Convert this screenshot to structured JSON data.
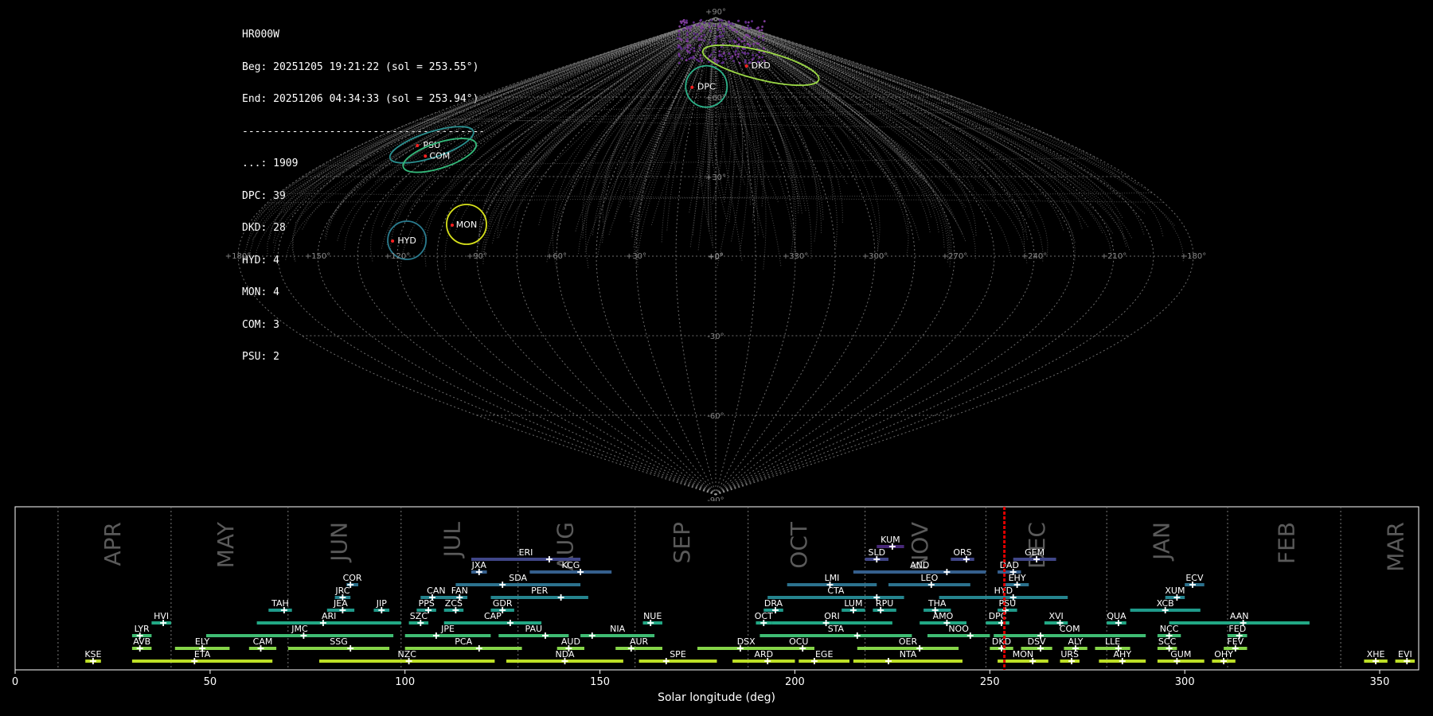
{
  "header": {
    "station": "HR000W",
    "begin": "Beg: 20251205 19:21:22 (sol = 253.55°)",
    "end": "End: 20251206 04:34:33 (sol = 253.94°)",
    "separator": "---------------------------------------",
    "counts": [
      "...: 1909",
      "DPC: 39",
      "DKD: 28",
      "HYD: 4",
      "MON: 4",
      "COM: 3",
      "PSU: 2"
    ]
  },
  "sky_map": {
    "projection": "sinusoidal",
    "lat_labels": [
      "+90°",
      "+60°",
      "+30°",
      "+0°",
      "-30°",
      "-60°",
      "-90°"
    ],
    "lon_labels": [
      "+180°",
      "+150°",
      "+120°",
      "+90°",
      "+60°",
      "+30°",
      "+0°",
      "+330°",
      "+300°",
      "+270°",
      "+240°",
      "+210°",
      "+180°"
    ],
    "radiants": [
      {
        "code": "DKD",
        "lon": 305,
        "lat": 72,
        "color": "#9bd845"
      },
      {
        "code": "DPC",
        "lon": 8,
        "lat": 64,
        "color": "#2db38a"
      },
      {
        "code": "PSU",
        "lon": 144,
        "lat": 42,
        "color": "#2a8f8f"
      },
      {
        "code": "COM",
        "lon": 132,
        "lat": 38,
        "color": "#33b97a"
      },
      {
        "code": "MON",
        "lon": 96,
        "lat": 12,
        "color": "#d8e21b"
      },
      {
        "code": "HYD",
        "lon": 117,
        "lat": 6,
        "color": "#2a7b8e"
      }
    ]
  },
  "chart_data": {
    "type": "range_timeline",
    "xlabel": "Solar longitude (deg)",
    "xlim": [
      0,
      360
    ],
    "xticks": [
      0,
      50,
      100,
      150,
      200,
      250,
      300,
      350
    ],
    "current_sol": 253.74,
    "months": [
      {
        "name": "APR",
        "start": 11,
        "mid": 25
      },
      {
        "name": "MAY",
        "start": 40,
        "mid": 54
      },
      {
        "name": "JUN",
        "start": 70,
        "mid": 83
      },
      {
        "name": "JUL",
        "start": 99,
        "mid": 112
      },
      {
        "name": "AUG",
        "start": 129,
        "mid": 141
      },
      {
        "name": "SEP",
        "start": 159,
        "mid": 171
      },
      {
        "name": "OCT",
        "start": 188,
        "mid": 201
      },
      {
        "name": "NOV",
        "start": 218,
        "mid": 232
      },
      {
        "name": "DEC",
        "start": 249,
        "mid": 262
      },
      {
        "name": "JAN",
        "start": 280,
        "mid": 294
      },
      {
        "name": "FEB",
        "start": 311,
        "mid": 326
      },
      {
        "name": "MAR",
        "start": 340,
        "mid": 354
      }
    ],
    "showers": [
      {
        "code": "KSE",
        "start": 18,
        "end": 22,
        "peak": 20,
        "row": 0,
        "color": "#bddf26"
      },
      {
        "code": "ETA",
        "start": 30,
        "end": 66,
        "peak": 46,
        "row": 0,
        "color": "#bddf26"
      },
      {
        "code": "NZC",
        "start": 78,
        "end": 123,
        "peak": 101,
        "row": 0,
        "color": "#bddf26"
      },
      {
        "code": "NDA",
        "start": 126,
        "end": 156,
        "peak": 141,
        "row": 0,
        "color": "#bddf26"
      },
      {
        "code": "SPE",
        "start": 160,
        "end": 180,
        "peak": 167,
        "row": 0,
        "color": "#bddf26"
      },
      {
        "code": "ARD",
        "start": 184,
        "end": 200,
        "peak": 193,
        "row": 0,
        "color": "#bddf26"
      },
      {
        "code": "EGE",
        "start": 201,
        "end": 214,
        "peak": 205,
        "row": 0,
        "color": "#bddf26"
      },
      {
        "code": "NTA",
        "start": 215,
        "end": 243,
        "peak": 224,
        "row": 0,
        "color": "#bddf26"
      },
      {
        "code": "MON",
        "start": 252,
        "end": 265,
        "peak": 261,
        "row": 0,
        "color": "#bddf26"
      },
      {
        "code": "URS",
        "start": 268,
        "end": 273,
        "peak": 271,
        "row": 0,
        "color": "#bddf26"
      },
      {
        "code": "AHY",
        "start": 278,
        "end": 290,
        "peak": 284,
        "row": 0,
        "color": "#bddf26"
      },
      {
        "code": "GUM",
        "start": 293,
        "end": 305,
        "peak": 298,
        "row": 0,
        "color": "#bddf26"
      },
      {
        "code": "OHY",
        "start": 307,
        "end": 313,
        "peak": 310,
        "row": 0,
        "color": "#bddf26"
      },
      {
        "code": "XHE",
        "start": 346,
        "end": 352,
        "peak": 349,
        "row": 0,
        "color": "#bddf26"
      },
      {
        "code": "EVI",
        "start": 354,
        "end": 359,
        "peak": 357,
        "row": 0,
        "color": "#bddf26"
      },
      {
        "code": "AVB",
        "start": 30,
        "end": 35,
        "peak": 32,
        "row": 1,
        "color": "#86d549"
      },
      {
        "code": "ELY",
        "start": 41,
        "end": 55,
        "peak": 48,
        "row": 1,
        "color": "#86d549"
      },
      {
        "code": "CAM",
        "start": 60,
        "end": 67,
        "peak": 63,
        "row": 1,
        "color": "#86d549"
      },
      {
        "code": "SSG",
        "start": 70,
        "end": 96,
        "peak": 86,
        "row": 1,
        "color": "#86d549"
      },
      {
        "code": "PCA",
        "start": 100,
        "end": 130,
        "peak": 119,
        "row": 1,
        "color": "#86d549"
      },
      {
        "code": "AUD",
        "start": 139,
        "end": 146,
        "peak": 142,
        "row": 1,
        "color": "#86d549"
      },
      {
        "code": "AUR",
        "start": 154,
        "end": 166,
        "peak": 158,
        "row": 1,
        "color": "#86d549"
      },
      {
        "code": "DSX",
        "start": 175,
        "end": 200,
        "peak": 186,
        "row": 1,
        "color": "#86d549"
      },
      {
        "code": "OCU",
        "start": 197,
        "end": 205,
        "peak": 202,
        "row": 1,
        "color": "#86d549"
      },
      {
        "code": "OER",
        "start": 216,
        "end": 242,
        "peak": 232,
        "row": 1,
        "color": "#86d549"
      },
      {
        "code": "DKD",
        "start": 250,
        "end": 256,
        "peak": 253,
        "row": 1,
        "color": "#86d549"
      },
      {
        "code": "DSV",
        "start": 258,
        "end": 266,
        "peak": 263,
        "row": 1,
        "color": "#86d549"
      },
      {
        "code": "ALY",
        "start": 269,
        "end": 275,
        "peak": 272,
        "row": 1,
        "color": "#86d549"
      },
      {
        "code": "LLE",
        "start": 277,
        "end": 286,
        "peak": 283,
        "row": 1,
        "color": "#86d549"
      },
      {
        "code": "SCC",
        "start": 293,
        "end": 298,
        "peak": 296,
        "row": 1,
        "color": "#86d549"
      },
      {
        "code": "FEV",
        "start": 310,
        "end": 316,
        "peak": 313,
        "row": 1,
        "color": "#86d549"
      },
      {
        "code": "LYR",
        "start": 30,
        "end": 35,
        "peak": 32,
        "row": 2,
        "color": "#3fbc73"
      },
      {
        "code": "JMC",
        "start": 49,
        "end": 97,
        "peak": 74,
        "row": 2,
        "color": "#3fbc73"
      },
      {
        "code": "JPE",
        "start": 100,
        "end": 122,
        "peak": 108,
        "row": 2,
        "color": "#3fbc73"
      },
      {
        "code": "PAU",
        "start": 124,
        "end": 142,
        "peak": 136,
        "row": 2,
        "color": "#3fbc73"
      },
      {
        "code": "NIA",
        "start": 145,
        "end": 164,
        "peak": 148,
        "row": 2,
        "color": "#3fbc73"
      },
      {
        "code": "STA",
        "start": 191,
        "end": 230,
        "peak": 216,
        "row": 2,
        "color": "#3fbc73"
      },
      {
        "code": "NOO",
        "start": 234,
        "end": 250,
        "peak": 245,
        "row": 2,
        "color": "#3fbc73"
      },
      {
        "code": "COM",
        "start": 251,
        "end": 290,
        "peak": 263,
        "row": 2,
        "color": "#3fbc73"
      },
      {
        "code": "NCC",
        "start": 293,
        "end": 299,
        "peak": 296,
        "row": 2,
        "color": "#3fbc73"
      },
      {
        "code": "FED",
        "start": 311,
        "end": 316,
        "peak": 314,
        "row": 2,
        "color": "#3fbc73"
      },
      {
        "code": "HVI",
        "start": 35,
        "end": 40,
        "peak": 38,
        "row": 3,
        "color": "#22a884"
      },
      {
        "code": "ARI",
        "start": 62,
        "end": 99,
        "peak": 79,
        "row": 3,
        "color": "#22a884"
      },
      {
        "code": "SZC",
        "start": 101,
        "end": 106,
        "peak": 104,
        "row": 3,
        "color": "#22a884"
      },
      {
        "code": "CAP",
        "start": 110,
        "end": 135,
        "peak": 127,
        "row": 3,
        "color": "#22a884"
      },
      {
        "code": "NUE",
        "start": 161,
        "end": 166,
        "peak": 163,
        "row": 3,
        "color": "#22a884"
      },
      {
        "code": "OCT",
        "start": 190,
        "end": 194,
        "peak": 192,
        "row": 3,
        "color": "#22a884"
      },
      {
        "code": "ORI",
        "start": 194,
        "end": 225,
        "peak": 208,
        "row": 3,
        "color": "#22a884"
      },
      {
        "code": "AMO",
        "start": 232,
        "end": 244,
        "peak": 239,
        "row": 3,
        "color": "#22a884"
      },
      {
        "code": "DPC",
        "start": 249,
        "end": 255,
        "peak": 253,
        "row": 3,
        "color": "#22a884"
      },
      {
        "code": "XVI",
        "start": 264,
        "end": 270,
        "peak": 268,
        "row": 3,
        "color": "#22a884"
      },
      {
        "code": "QUA",
        "start": 280,
        "end": 285,
        "peak": 283,
        "row": 3,
        "color": "#22a884"
      },
      {
        "code": "AAN",
        "start": 296,
        "end": 332,
        "peak": 315,
        "row": 3,
        "color": "#22a884"
      },
      {
        "code": "TAH",
        "start": 65,
        "end": 71,
        "peak": 69,
        "row": 4,
        "color": "#1f9a8a"
      },
      {
        "code": "JEA",
        "start": 80,
        "end": 87,
        "peak": 84,
        "row": 4,
        "color": "#1f9a8a"
      },
      {
        "code": "JIP",
        "start": 92,
        "end": 96,
        "peak": 94,
        "row": 4,
        "color": "#1f9a8a"
      },
      {
        "code": "PPS",
        "start": 103,
        "end": 108,
        "peak": 106,
        "row": 4,
        "color": "#1f9a8a"
      },
      {
        "code": "ZCS",
        "start": 110,
        "end": 115,
        "peak": 113,
        "row": 4,
        "color": "#1f9a8a"
      },
      {
        "code": "GDR",
        "start": 122,
        "end": 128,
        "peak": 125,
        "row": 4,
        "color": "#1f9a8a"
      },
      {
        "code": "DRA",
        "start": 192,
        "end": 197,
        "peak": 195,
        "row": 4,
        "color": "#1f9a8a"
      },
      {
        "code": "LUM",
        "start": 212,
        "end": 218,
        "peak": 215,
        "row": 4,
        "color": "#1f9a8a"
      },
      {
        "code": "RPU",
        "start": 220,
        "end": 226,
        "peak": 222,
        "row": 4,
        "color": "#1f9a8a"
      },
      {
        "code": "THA",
        "start": 233,
        "end": 240,
        "peak": 236,
        "row": 4,
        "color": "#1f9a8a"
      },
      {
        "code": "PSU",
        "start": 252,
        "end": 257,
        "peak": 254,
        "row": 4,
        "color": "#1f9a8a"
      },
      {
        "code": "XCB",
        "start": 286,
        "end": 304,
        "peak": 295,
        "row": 4,
        "color": "#1f9a8a"
      },
      {
        "code": "JRC",
        "start": 82,
        "end": 86,
        "peak": 84,
        "row": 5,
        "color": "#25848e"
      },
      {
        "code": "CAN",
        "start": 104,
        "end": 112,
        "peak": 107,
        "row": 5,
        "color": "#25848e"
      },
      {
        "code": "FAN",
        "start": 112,
        "end": 116,
        "peak": 114,
        "row": 5,
        "color": "#25848e"
      },
      {
        "code": "PER",
        "start": 122,
        "end": 147,
        "peak": 140,
        "row": 5,
        "color": "#25848e"
      },
      {
        "code": "CTA",
        "start": 193,
        "end": 228,
        "peak": 221,
        "row": 5,
        "color": "#25848e"
      },
      {
        "code": "HYD",
        "start": 237,
        "end": 270,
        "peak": 256,
        "row": 5,
        "color": "#25848e"
      },
      {
        "code": "XUM",
        "start": 295,
        "end": 300,
        "peak": 298,
        "row": 5,
        "color": "#25848e"
      },
      {
        "code": "COR",
        "start": 85,
        "end": 88,
        "peak": 86,
        "row": 6,
        "color": "#2c728e"
      },
      {
        "code": "SDA",
        "start": 113,
        "end": 145,
        "peak": 125,
        "row": 6,
        "color": "#2c728e"
      },
      {
        "code": "LMI",
        "start": 198,
        "end": 221,
        "peak": 209,
        "row": 6,
        "color": "#2c728e"
      },
      {
        "code": "LEO",
        "start": 224,
        "end": 245,
        "peak": 235,
        "row": 6,
        "color": "#2c728e"
      },
      {
        "code": "EHY",
        "start": 254,
        "end": 260,
        "peak": 257,
        "row": 6,
        "color": "#2c728e"
      },
      {
        "code": "ECV",
        "start": 300,
        "end": 305,
        "peak": 302,
        "row": 6,
        "color": "#2c728e"
      },
      {
        "code": "JXA",
        "start": 117,
        "end": 121,
        "peak": 119,
        "row": 7,
        "color": "#355f8d"
      },
      {
        "code": "KCG",
        "start": 132,
        "end": 153,
        "peak": 145,
        "row": 7,
        "color": "#355f8d"
      },
      {
        "code": "AND",
        "start": 215,
        "end": 249,
        "peak": 239,
        "row": 7,
        "color": "#355f8d"
      },
      {
        "code": "DAD",
        "start": 252,
        "end": 258,
        "peak": 256,
        "row": 7,
        "color": "#355f8d"
      },
      {
        "code": "ERI",
        "start": 117,
        "end": 145,
        "peak": 137,
        "row": 8,
        "color": "#404688"
      },
      {
        "code": "SLD",
        "start": 218,
        "end": 224,
        "peak": 221,
        "row": 8,
        "color": "#404688"
      },
      {
        "code": "ORS",
        "start": 240,
        "end": 246,
        "peak": 244,
        "row": 8,
        "color": "#404688"
      },
      {
        "code": "GEM",
        "start": 256,
        "end": 267,
        "peak": 262,
        "row": 8,
        "color": "#404688"
      },
      {
        "code": "KUM",
        "start": 221,
        "end": 228,
        "peak": 225,
        "row": 9,
        "color": "#482878"
      }
    ]
  }
}
